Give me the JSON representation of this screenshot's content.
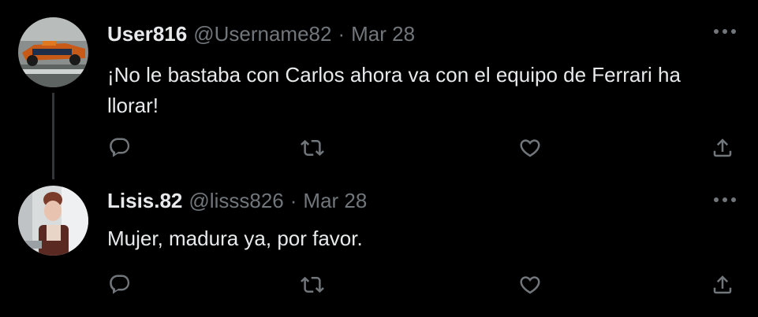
{
  "tweets": [
    {
      "display_name": "User816",
      "handle": "@Username82",
      "separator": "·",
      "date": "Mar 28",
      "text": "¡No le bastaba con Carlos ahora va con el equipo de Ferrari ha llorar!",
      "avatar": "race-car-photo"
    },
    {
      "display_name": "Lisis.82",
      "handle": "@lisss826",
      "separator": "·",
      "date": "Mar 28",
      "text": "Mujer, madura ya, por favor.",
      "avatar": "woman-portrait-photo"
    }
  ],
  "icons": {
    "more": "more-horizontal-icon",
    "reply": "reply-icon",
    "retweet": "retweet-icon",
    "like": "heart-icon",
    "share": "share-icon"
  },
  "colors": {
    "background": "#000000",
    "text_primary": "#e7e9ea",
    "text_secondary": "#71767b",
    "thread_line": "#333639"
  }
}
